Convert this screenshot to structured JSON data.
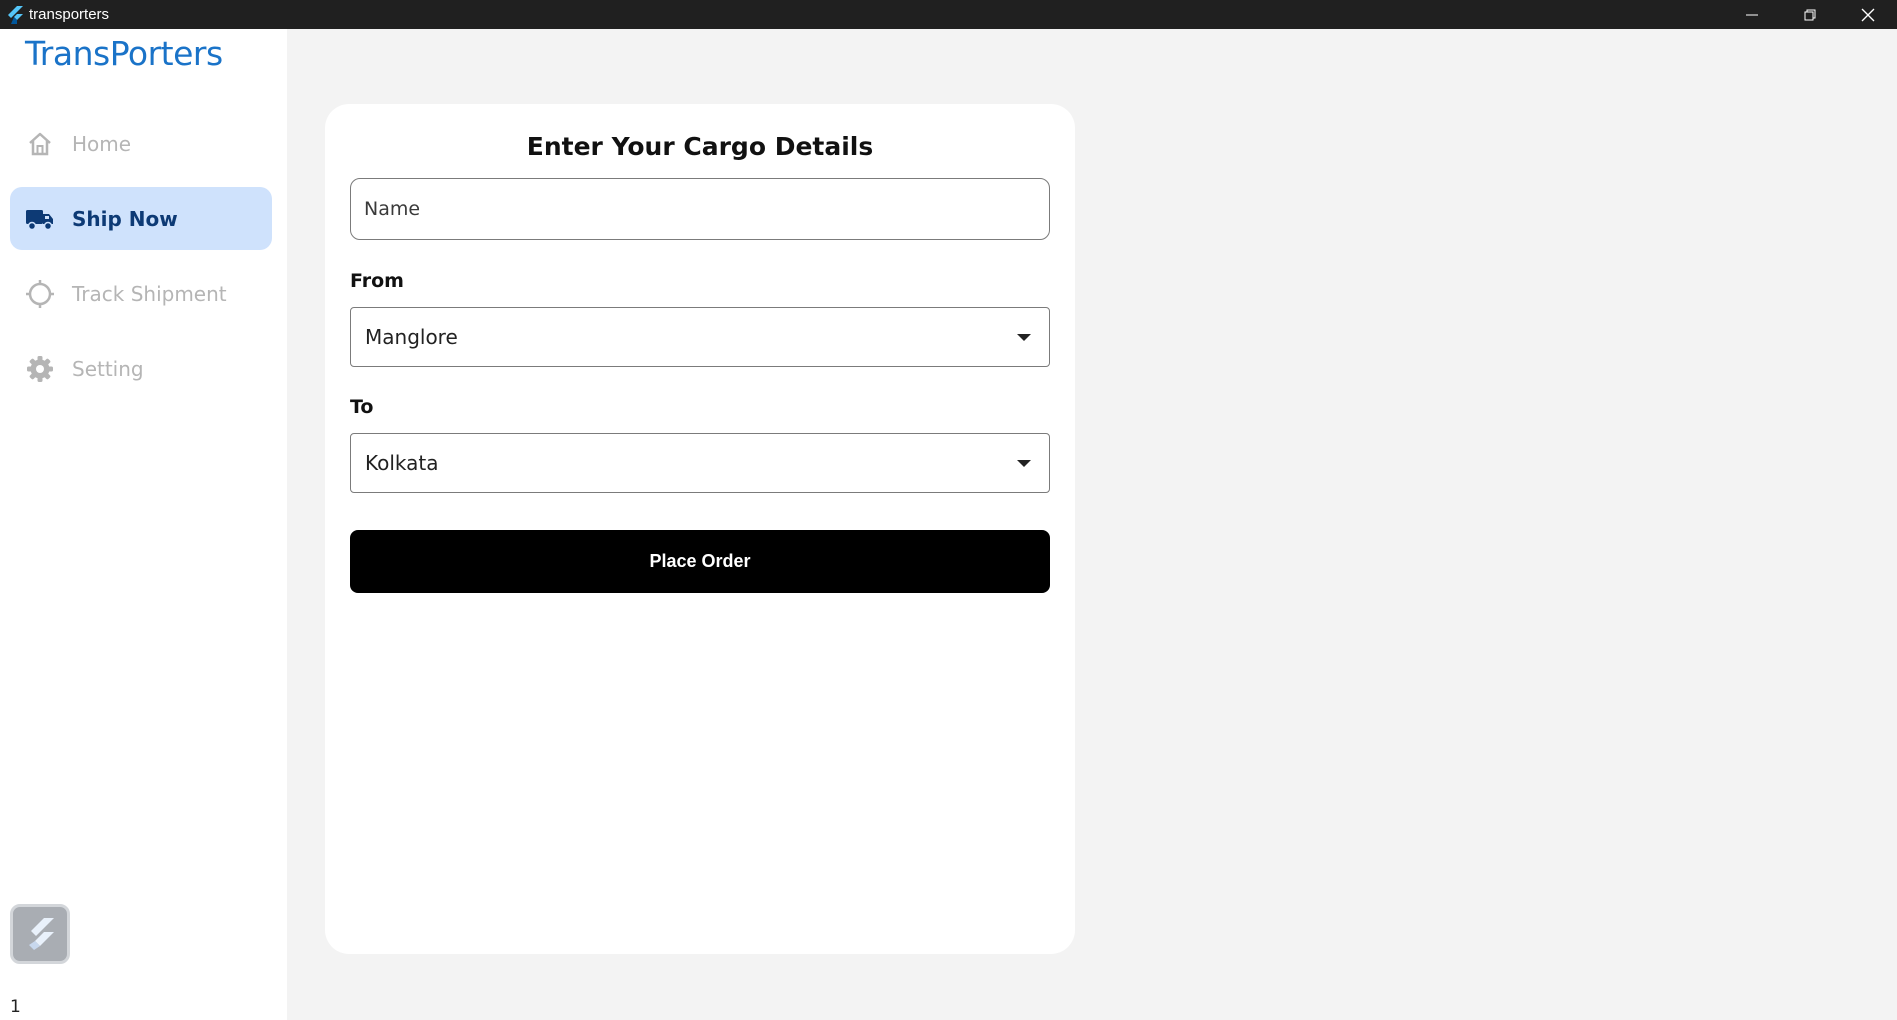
{
  "window": {
    "title": "transporters"
  },
  "sidebar": {
    "brand": "TransPorters",
    "items": [
      {
        "label": "Home",
        "icon": "home-icon",
        "active": false
      },
      {
        "label": "Ship Now",
        "icon": "truck-icon",
        "active": true
      },
      {
        "label": "Track Shipment",
        "icon": "crosshair-icon",
        "active": false
      },
      {
        "label": "Setting",
        "icon": "gear-icon",
        "active": false
      }
    ],
    "footer_number": "1"
  },
  "form": {
    "title": "Enter Your Cargo Details",
    "name_placeholder": "Name",
    "from_label": "From",
    "from_value": "Manglore",
    "to_label": "To",
    "to_value": "Kolkata",
    "submit_label": "Place Order"
  },
  "colors": {
    "brand": "#1a73c8",
    "active_nav_bg": "#cfe2fc",
    "active_nav_text": "#0d3a75",
    "button_bg": "#000000"
  }
}
